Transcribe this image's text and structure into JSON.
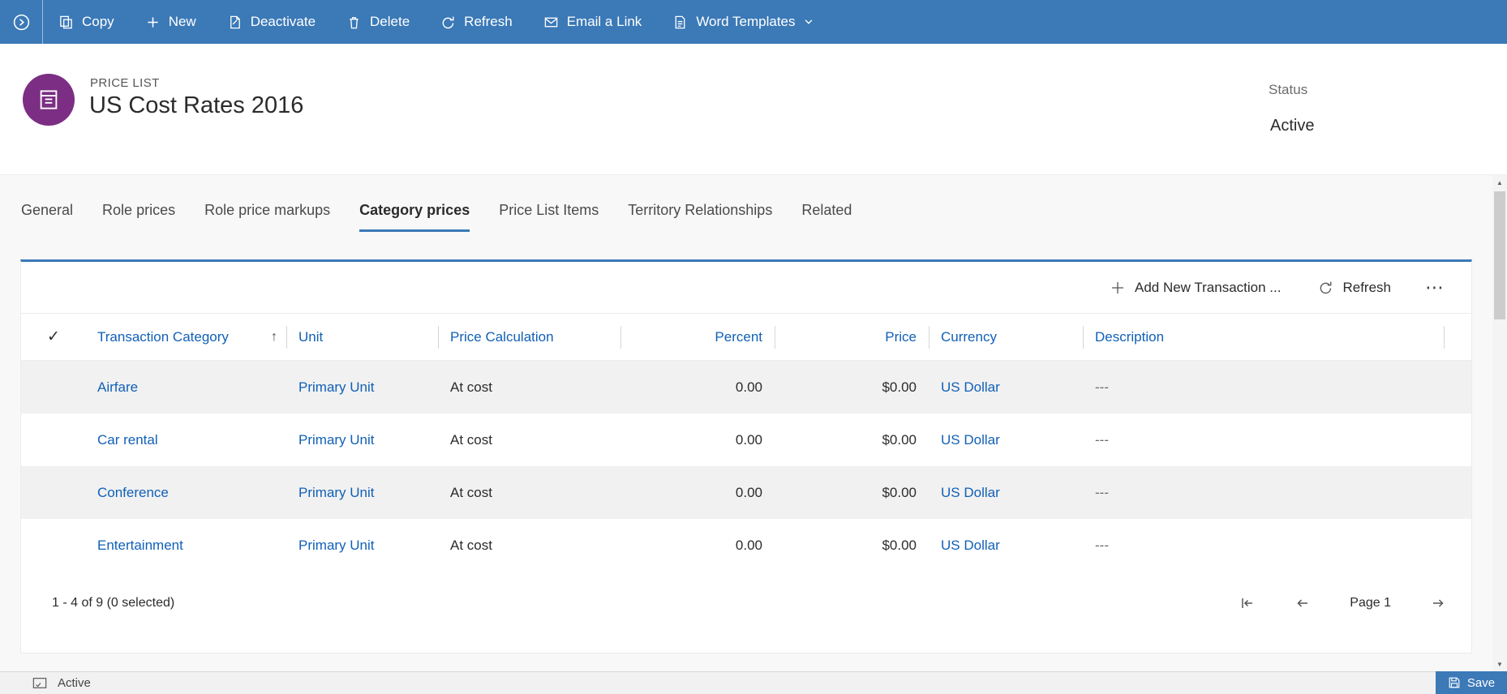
{
  "commandbar": {
    "items": [
      {
        "label": "Copy"
      },
      {
        "label": "New"
      },
      {
        "label": "Deactivate"
      },
      {
        "label": "Delete"
      },
      {
        "label": "Refresh"
      },
      {
        "label": "Email a Link"
      },
      {
        "label": "Word Templates"
      }
    ]
  },
  "header": {
    "entity_type": "PRICE LIST",
    "title": "US Cost Rates 2016",
    "status_label": "Status",
    "status_value": "Active"
  },
  "tabs": [
    {
      "label": "General",
      "active": false
    },
    {
      "label": "Role prices",
      "active": false
    },
    {
      "label": "Role price markups",
      "active": false
    },
    {
      "label": "Category prices",
      "active": true
    },
    {
      "label": "Price List Items",
      "active": false
    },
    {
      "label": "Territory Relationships",
      "active": false
    },
    {
      "label": "Related",
      "active": false
    }
  ],
  "grid": {
    "toolbar": {
      "add_new": "Add New Transaction ...",
      "refresh": "Refresh"
    },
    "columns": {
      "category": "Transaction Category",
      "unit": "Unit",
      "calc": "Price Calculation",
      "percent": "Percent",
      "price": "Price",
      "currency": "Currency",
      "description": "Description"
    },
    "rows": [
      {
        "category": "Airfare",
        "unit": "Primary Unit",
        "calc": "At cost",
        "percent": "0.00",
        "price": "$0.00",
        "currency": "US Dollar",
        "description": "---"
      },
      {
        "category": "Car rental",
        "unit": "Primary Unit",
        "calc": "At cost",
        "percent": "0.00",
        "price": "$0.00",
        "currency": "US Dollar",
        "description": "---"
      },
      {
        "category": "Conference",
        "unit": "Primary Unit",
        "calc": "At cost",
        "percent": "0.00",
        "price": "$0.00",
        "currency": "US Dollar",
        "description": "---"
      },
      {
        "category": "Entertainment",
        "unit": "Primary Unit",
        "calc": "At cost",
        "percent": "0.00",
        "price": "$0.00",
        "currency": "US Dollar",
        "description": "---"
      }
    ],
    "footer": {
      "count": "1 - 4 of 9 (0 selected)",
      "page": "Page 1"
    }
  },
  "statusbar": {
    "state": "Active",
    "save": "Save"
  },
  "icons": {
    "check": "✓",
    "sort_asc": "↑",
    "more": "⋯",
    "scroll_up": "▲",
    "scroll_down": "▼"
  },
  "colors": {
    "commandbar_blue": "#3B79B7",
    "link_blue": "#1160B7",
    "entity_icon_purple": "#7B2E83",
    "row_alt_gray": "#F1F1F1",
    "page_background": "#F8F8F8"
  }
}
